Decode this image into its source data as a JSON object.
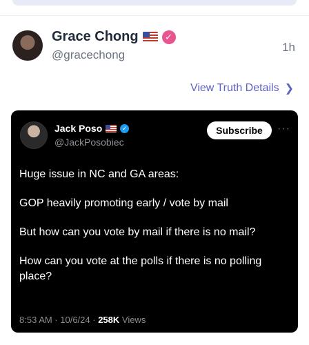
{
  "post": {
    "author_name": "Grace Chong",
    "author_handle": "@gracechong",
    "time": "1h",
    "view_details": "View Truth Details",
    "verified_color": "#e8548e"
  },
  "embed": {
    "author_name": "Jack Poso",
    "author_handle": "@JackPosobiec",
    "subscribe_label": "Subscribe",
    "more_label": "···",
    "paragraphs": [
      "Huge issue in NC and GA areas:",
      "GOP heavily promoting early / vote by mail",
      "But how can you vote by mail if there is no mail?",
      "How can you vote at the polls if there is no polling place?"
    ],
    "meta_time": "8:53 AM · 10/6/24 · ",
    "views_count": "258K",
    "views_label": " Views",
    "verified_color": "#1d9bf0"
  },
  "icons": {
    "verified_mark": "✓",
    "chevron": "❯"
  }
}
